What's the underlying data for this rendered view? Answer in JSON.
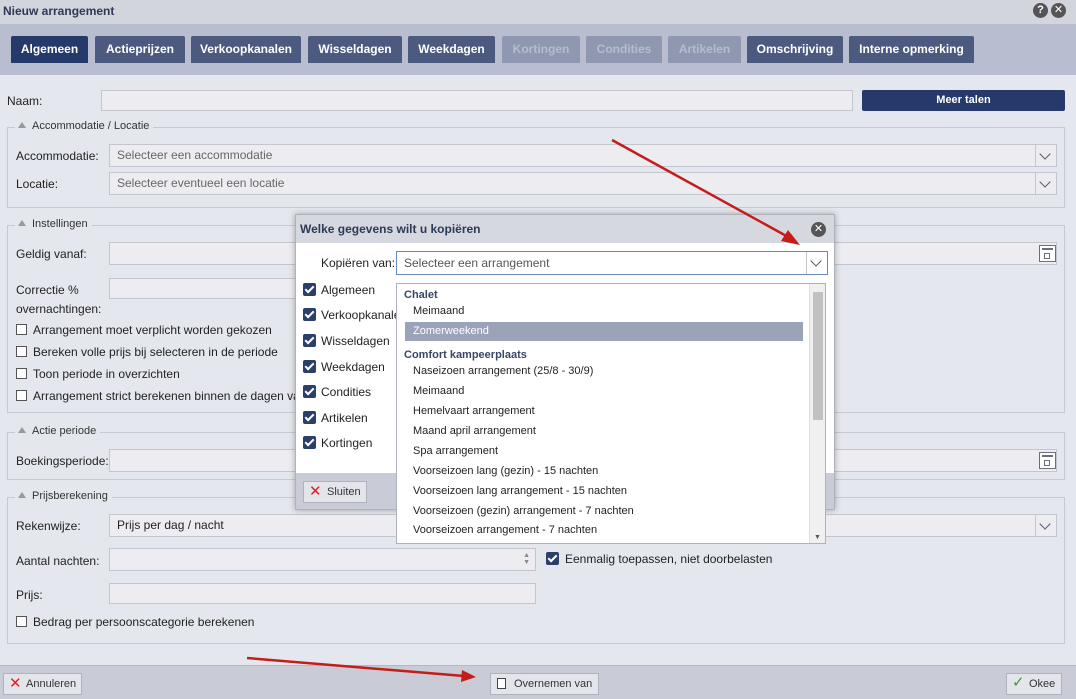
{
  "window": {
    "title": "Nieuw arrangement",
    "help_icon": "?",
    "close_icon": "✕"
  },
  "tabs": [
    {
      "label": "Algemeen",
      "state": "active"
    },
    {
      "label": "Actieprijzen",
      "state": "normal"
    },
    {
      "label": "Verkoopkanalen",
      "state": "normal"
    },
    {
      "label": "Wisseldagen",
      "state": "normal"
    },
    {
      "label": "Weekdagen",
      "state": "normal"
    },
    {
      "label": "Kortingen",
      "state": "disabled"
    },
    {
      "label": "Condities",
      "state": "disabled"
    },
    {
      "label": "Artikelen",
      "state": "disabled"
    },
    {
      "label": "Omschrijving",
      "state": "normal"
    },
    {
      "label": "Interne opmerking",
      "state": "normal"
    }
  ],
  "form": {
    "naam_label": "Naam:",
    "naam_value": "",
    "meer_talen": "Meer talen",
    "accommodatie_section": "Accommodatie / Locatie",
    "accommodatie_label": "Accommodatie:",
    "accommodatie_placeholder": "Selecteer een accommodatie",
    "locatie_label": "Locatie:",
    "locatie_placeholder": "Selecteer eventueel een locatie",
    "instellingen_section": "Instellingen",
    "geldig_vanaf_label": "Geldig vanaf:",
    "correctie_label_1": "Correctie %",
    "correctie_label_2": "overnachtingen:",
    "cb_verplicht": "Arrangement moet verplicht worden gekozen",
    "cb_volle_prijs": "Bereken volle prijs bij selecteren in de periode",
    "cb_toon_periode": "Toon periode in overzichten",
    "cb_strict": "Arrangement strict berekenen binnen de dagen van",
    "actie_section": "Actie periode",
    "boekingsperiode_label": "Boekingsperiode:",
    "prijs_section": "Prijsberekening",
    "rekenwijze_label": "Rekenwijze:",
    "rekenwijze_value": "Prijs per dag / nacht",
    "aantal_nachten_label": "Aantal nachten:",
    "eenmalig_label": "Eenmalig toepassen, niet doorbelasten",
    "prijs_label": "Prijs:",
    "cb_persoonscategorie": "Bedrag per persoonscategorie berekenen"
  },
  "footer": {
    "annuleren": "Annuleren",
    "overnemen": "Overnemen van",
    "okee": "Okee"
  },
  "dialog": {
    "title": "Welke gegevens wilt u kopiëren",
    "kopieren_label": "Kopiëren van:",
    "kopieren_placeholder": "Selecteer een arrangement",
    "checkboxes": [
      "Algemeen",
      "Verkoopkanale",
      "Wisseldagen",
      "Weekdagen",
      "Condities",
      "Artikelen",
      "Kortingen"
    ],
    "sluiten": "Sluiten"
  },
  "dropdown": {
    "groups": [
      {
        "name": "Chalet",
        "items": [
          "Meimaand",
          "Zomerweekend"
        ]
      },
      {
        "name": "Comfort kampeerplaats",
        "items": [
          "Naseizoen arrangement (25/8 - 30/9)",
          "Meimaand",
          "Hemelvaart arrangement",
          "Maand april arrangement",
          "Spa arrangement",
          "Voorseizoen lang (gezin) - 15 nachten",
          "Voorseizoen lang arrangement - 15 nachten",
          "Voorseizoen (gezin) arrangement - 7 nachten",
          "Voorseizoen arrangement - 7 nachten"
        ]
      }
    ],
    "selected_item": "Zomerweekend"
  },
  "colors": {
    "tab_active": "#253a6a",
    "tab_normal": "#4b5a7e",
    "tab_disabled": "#8f98b0",
    "annotation_arrow": "#c61b1b"
  }
}
